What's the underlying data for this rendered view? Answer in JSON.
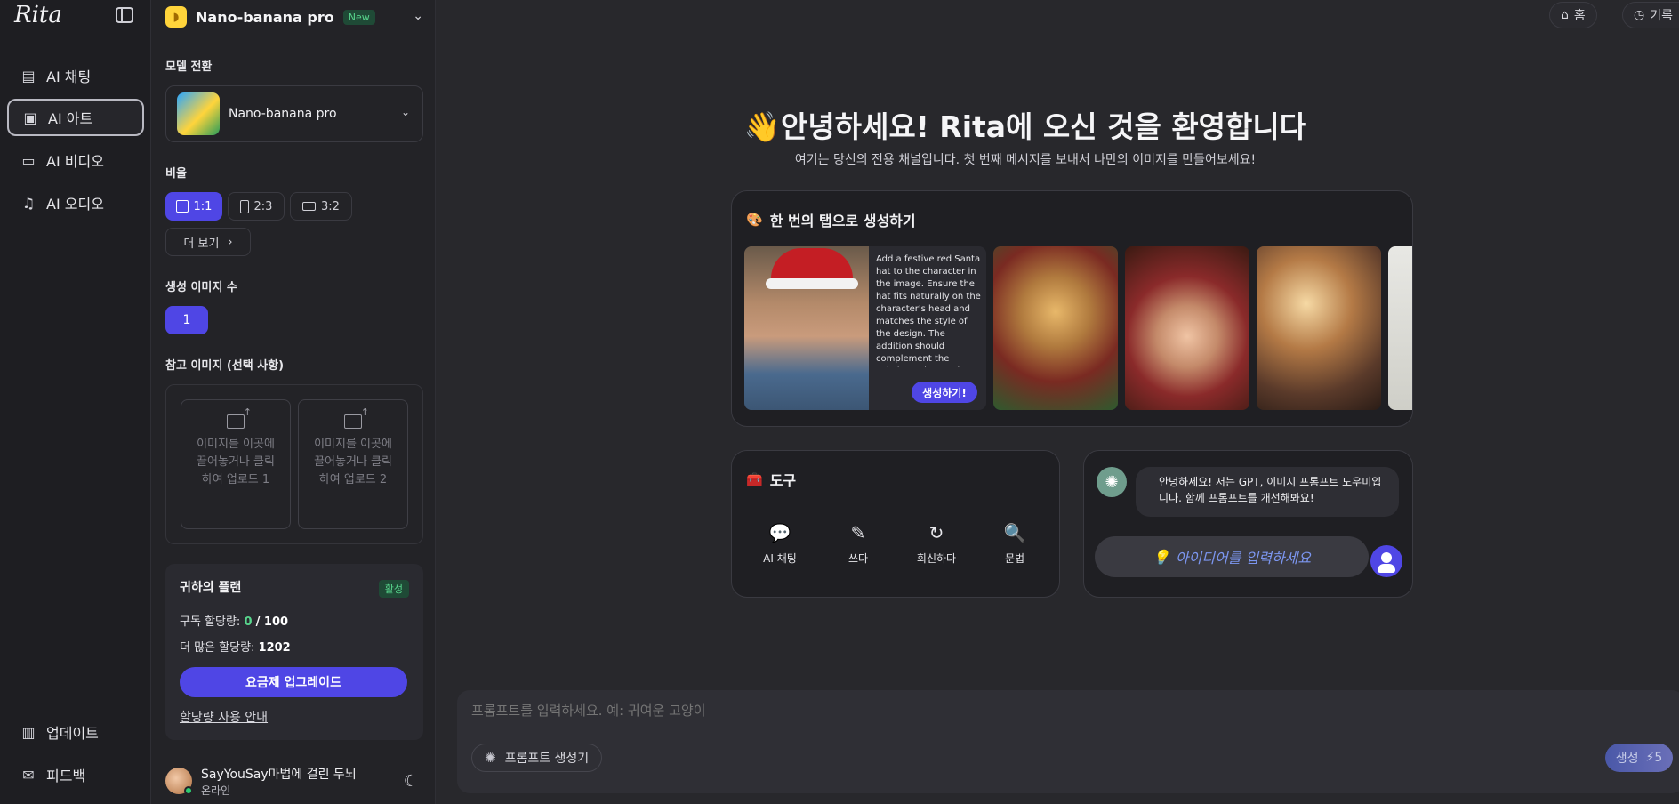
{
  "app": {
    "logo": "Rita"
  },
  "nav": {
    "items": [
      {
        "label": "AI 채팅"
      },
      {
        "label": "AI 아트"
      },
      {
        "label": "AI 비디오"
      },
      {
        "label": "AI 오디오"
      }
    ],
    "bottom": [
      {
        "label": "업데이트"
      },
      {
        "label": "피드백"
      }
    ]
  },
  "panel": {
    "header": {
      "title": "Nano-banana pro",
      "badge": "New"
    },
    "model_switch_label": "모델 전환",
    "model_name": "Nano-banana pro",
    "ratio_label": "비율",
    "ratios": [
      "1:1",
      "2:3",
      "3:2"
    ],
    "ratio_more": "더 보기",
    "count_label": "생성 이미지 수",
    "count_value": "1",
    "reference_label": "참고 이미지 (선택 사항)",
    "upload1": "이미지를 이곳에 끌어놓거나 클릭하여 업로드 1",
    "upload2": "이미지를 이곳에 끌어놓거나 클릭하여 업로드 2",
    "plan": {
      "title": "귀하의 플랜",
      "status": "활성",
      "sub_quota_label": "구독 할당량:",
      "sub_quota_used": "0",
      "sub_quota_total": "100",
      "more_quota_label": "더 많은 할당량:",
      "more_quota_value": "1202",
      "upgrade": "요금제 업그레이드",
      "quota_link": "할당량 사용 안내"
    },
    "user": {
      "name": "SayYouSay마법에 걸린 두뇌",
      "status": "온라인"
    }
  },
  "topbar": {
    "home": "홈",
    "history": "기록"
  },
  "welcome": {
    "title": "안녕하세요! Rita에 오신 것을 환영합니다",
    "subtitle": "여기는 당신의 전용 채널입니다. 첫 번째 메시지를 보내서 나만의 이미지를 만들어보세요!"
  },
  "quick": {
    "title": "한 번의 탭으로 생성하기",
    "prompt": "Add a festive red Santa hat to the character in the image. Ensure the hat fits naturally on the character's head and matches the style of the design. The addition should complement the existing colors and moo...",
    "generate": "생성하기!"
  },
  "tools": {
    "title": "도구",
    "items": [
      {
        "label": "AI 채팅"
      },
      {
        "label": "쓰다"
      },
      {
        "label": "회신하다"
      },
      {
        "label": "문법"
      }
    ]
  },
  "chat": {
    "message": "안녕하세요! 저는 GPT, 이미지 프롬프트 도우미입니다. 함께 프롬프트를 개선해봐요!",
    "idea_placeholder": "아이디어를 입력하세요"
  },
  "composer": {
    "placeholder": "프롬프트를 입력하세요. 예: 귀여운 고양이",
    "prompt_gen": "프롬프트 생성기",
    "generate": "생성",
    "cost": "5"
  }
}
